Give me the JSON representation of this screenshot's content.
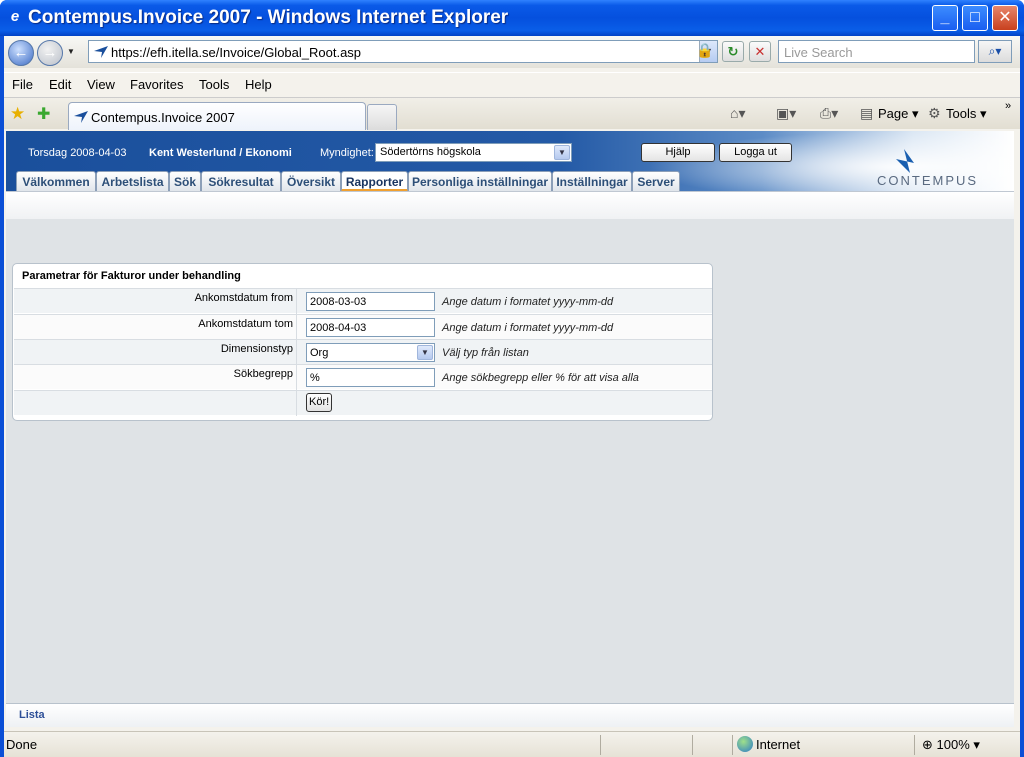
{
  "window": {
    "title": "Contempus.Invoice 2007 - Windows Internet Explorer",
    "minimize": "_",
    "maximize": "□",
    "close": "✕"
  },
  "address_bar": {
    "url": "https://efh.itella.se/Invoice/Global_Root.asp",
    "search_placeholder": "Live Search"
  },
  "menu": {
    "items": [
      "File",
      "Edit",
      "View",
      "Favorites",
      "Tools",
      "Help"
    ]
  },
  "tabs_bar": {
    "tab_title": "Contempus.Invoice 2007",
    "page_label": "Page",
    "tools_label": "Tools"
  },
  "app_header": {
    "date": "Torsdag 2008-04-03",
    "user": "Kent Westerlund / Ekonomi",
    "authority_label": "Myndighet:",
    "authority_value": "Södertörns högskola",
    "help_label": "Hjälp",
    "logout_label": "Logga ut",
    "logo_text": "CONTEMPUS",
    "tabs": [
      "Välkommen",
      "Arbetslista",
      "Sök",
      "Sökresultat",
      "Översikt",
      "Rapporter",
      "Personliga inställningar",
      "Inställningar",
      "Server"
    ],
    "active_tab": "Rapporter"
  },
  "form": {
    "title": "Parametrar för Fakturor under behandling",
    "rows": [
      {
        "label": "Ankomstdatum from",
        "value": "2008-03-03",
        "hint": "Ange datum i formatet yyyy-mm-dd"
      },
      {
        "label": "Ankomstdatum tom",
        "value": "2008-04-03",
        "hint": "Ange datum i formatet yyyy-mm-dd"
      },
      {
        "label": "Dimensionstyp",
        "value": "Org",
        "hint": "Välj typ från listan"
      },
      {
        "label": "Sökbegrepp",
        "value": "%",
        "hint": "Ange sökbegrepp eller % för att visa alla"
      }
    ],
    "run_label": "Kör!"
  },
  "footer": {
    "link": "Lista"
  },
  "status": {
    "text": "Done",
    "zone": "Internet",
    "zoom": "100%"
  }
}
